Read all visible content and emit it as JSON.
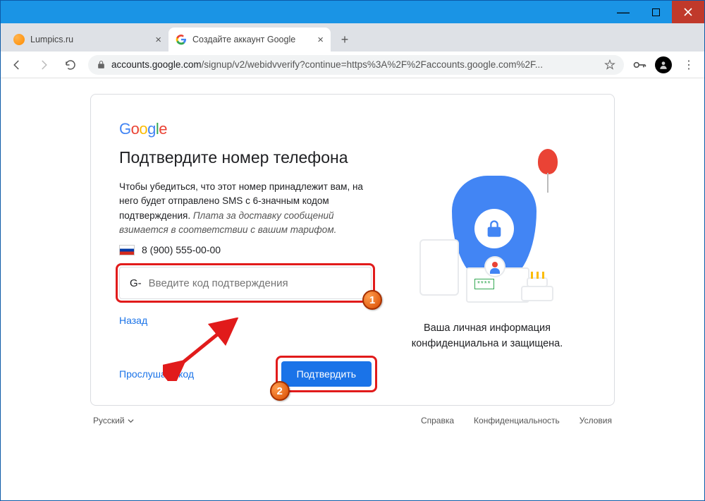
{
  "window": {
    "tabs": [
      {
        "title": "Lumpics.ru",
        "active": false
      },
      {
        "title": "Создайте аккаунт Google",
        "active": true
      }
    ],
    "url_host": "accounts.google.com",
    "url_path": "/signup/v2/webidvverify?continue=https%3A%2F%2Faccounts.google.com%2F..."
  },
  "page": {
    "logo_text": "Google",
    "headline": "Подтвердите номер телефона",
    "body_main": "Чтобы убедиться, что этот номер принадлежит вам, на него будет отправлено SMS с 6-значным кодом подтверждения. ",
    "body_italic": "Плата за доставку сообщений взимается в соответствии с вашим тарифом.",
    "phone": "8 (900) 555-00-00",
    "input_prefix": "G-",
    "input_placeholder": "Введите код подтверждения",
    "back_label": "Назад",
    "listen_label": "Прослушать код",
    "confirm_label": "Подтвердить",
    "caption": "Ваша личная информация конфиденциальна и защищена."
  },
  "footer": {
    "language": "Русский",
    "links": {
      "help": "Справка",
      "privacy": "Конфиденциальность",
      "terms": "Условия"
    }
  },
  "annotations": {
    "badge1": "1",
    "badge2": "2"
  }
}
